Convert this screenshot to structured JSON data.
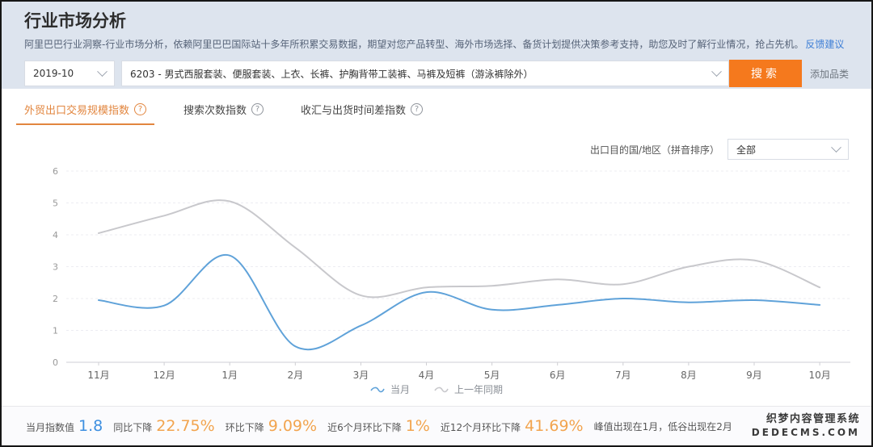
{
  "header": {
    "title": "行业市场分析",
    "subtitle": "阿里巴巴行业洞察-行业市场分析，依赖阿里巴巴国际站十多年所积累交易数据，期望对您产品转型、海外市场选择、备货计划提供决策参考支持，助您及时了解行业情况，抢占先机。",
    "feedback_link": "反馈建议",
    "date_value": "2019-10",
    "category_value": "6203 - 男式西服套装、便服套装、上衣、长裤、护胸背带工装裤、马裤及短裤（游泳裤除外）",
    "search_label": "搜索",
    "add_category_label": "添加品类"
  },
  "tabs": [
    {
      "label": "外贸出口交易规模指数",
      "help_icon": "question-circle",
      "active": true
    },
    {
      "label": "搜索次数指数",
      "help_icon": "question-circle",
      "active": false
    },
    {
      "label": "收汇与出货时间差指数",
      "help_icon": "question-circle",
      "active": false
    }
  ],
  "chart_controls": {
    "region_label": "出口目的国/地区（拼音排序）",
    "region_value": "全部"
  },
  "chart_data": {
    "type": "line",
    "title": "",
    "xlabel": "",
    "ylabel": "",
    "ylim": [
      0,
      6
    ],
    "y_ticks": [
      0,
      1,
      2,
      3,
      4,
      5,
      6
    ],
    "grid": "dashed-horizontal",
    "legend_position": "bottom-center",
    "categories": [
      "11月",
      "12月",
      "1月",
      "2月",
      "3月",
      "4月",
      "5月",
      "6月",
      "7月",
      "8月",
      "9月",
      "10月"
    ],
    "series": [
      {
        "name": "当月",
        "color": "#5fa2d9",
        "values": [
          1.95,
          1.78,
          3.35,
          0.5,
          1.15,
          2.2,
          1.65,
          1.8,
          2.0,
          1.88,
          1.95,
          1.8
        ]
      },
      {
        "name": "上一年同期",
        "color": "#c8c8cc",
        "values": [
          4.05,
          4.6,
          5.05,
          3.6,
          2.1,
          2.35,
          2.4,
          2.6,
          2.45,
          3.0,
          3.2,
          2.35
        ]
      }
    ]
  },
  "stats": {
    "items": [
      {
        "label": "当月指数值",
        "value": "1.8",
        "color": "blue"
      },
      {
        "label": "同比下降",
        "value": "22.75%",
        "color": "orange"
      },
      {
        "label": "环比下降",
        "value": "9.09%",
        "color": "orange"
      },
      {
        "label": "近6个月环比下降",
        "value": "1%",
        "color": "orange"
      },
      {
        "label": "近12个月环比下降",
        "value": "41.69%",
        "color": "orange"
      },
      {
        "label": "峰值出现在1月，低谷出现在2月",
        "value": "",
        "color": ""
      }
    ]
  },
  "watermark": {
    "line1": "织梦内容管理系统",
    "line2": "DEDECMS.COM"
  },
  "theme": {
    "header_bg": "#dde4ee",
    "accent_orange": "#f5791d",
    "tab_orange": "#e2863f",
    "value_blue": "#3d8fe0",
    "value_orange": "#f2a44e"
  }
}
